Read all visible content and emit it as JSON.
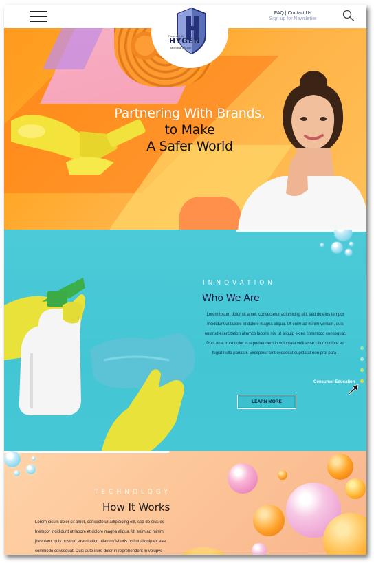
{
  "header": {
    "top_links": {
      "faq": "FAQ",
      "separator": "|",
      "contact": "Contact Us",
      "newsletter": "Sign up for Newsletter"
    },
    "logo": {
      "powered_by": "Powered By",
      "name": "HYGEN",
      "subtitle": "Microbial Control"
    }
  },
  "hero": {
    "title_line1": "Partnering With Brands,",
    "title_line2": "to Make",
    "title_line3": "A Safer World"
  },
  "who_we_are": {
    "label": "INNOVATION",
    "title": "Who We Are",
    "body": "Lorem ipsum dolor sit amet, consectetur adipisicing elit, sed do eius tempor incididunt ut labore et dolore magna aliqua. Ut enim ad minim veniam, quis nostrud exercitation ullamco laboris nisi ut aliquip ex ea commodo consequat. Duis aute irure dolor in reprehenderit in voluptate velit esse cillum dolore eu fugiat nulla pariatur. Excepteur sint occaecat cupidatat non proi pafa .",
    "button": "LEARN MORE",
    "side_nav_active": "Consumer Education"
  },
  "how_it_works": {
    "label": "TECHNOLOGY",
    "title": "How It Works",
    "body": "Lorem ipsum dolor sit amet, consectetur adipisicing elit, sed do eius ee htempor incididunt ut labore et dolore magna aliqua. Ut enim ad minim jbveniam, quis nostrud exercitation ullamco laboris nisi ut aliquip ex eae commodo consequat. Duis aute irure dolor in reprehenderit in volupve-"
  },
  "colors": {
    "hero_orange": "#ffa726",
    "teal": "#46c7d5",
    "peach": "#fcc698",
    "navy": "#0b1440",
    "logo_blue": "#5b6fb6"
  },
  "icons": [
    "menu-icon",
    "search-icon",
    "shield-logo-icon",
    "cursor-arrow-icon"
  ]
}
